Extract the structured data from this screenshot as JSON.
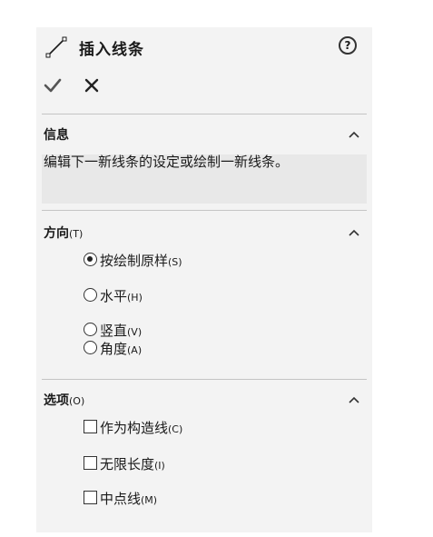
{
  "panel": {
    "title": "插入线条",
    "help_label": "?",
    "ok_icon": "checkmark-icon",
    "cancel_icon": "x-icon"
  },
  "message": {
    "title": "信息",
    "text": "编辑下一新线条的设定或绘制一新线条。"
  },
  "orientation": {
    "title": "方向",
    "hotkey": "(T)",
    "options": [
      {
        "label": "按绘制原样",
        "hotkey": "(S)",
        "selected": true
      },
      {
        "label": "水平",
        "hotkey": "(H)",
        "selected": false
      },
      {
        "label": "竖直",
        "hotkey": "(V)",
        "selected": false
      },
      {
        "label": "角度",
        "hotkey": "(A)",
        "selected": false
      }
    ]
  },
  "options": {
    "title": "选项",
    "hotkey": "(O)",
    "items": [
      {
        "label": "作为构造线",
        "hotkey": "(C)",
        "checked": false
      },
      {
        "label": "无限长度",
        "hotkey": "(I)",
        "checked": false
      },
      {
        "label": "中点线",
        "hotkey": "(M)",
        "checked": false
      }
    ]
  }
}
